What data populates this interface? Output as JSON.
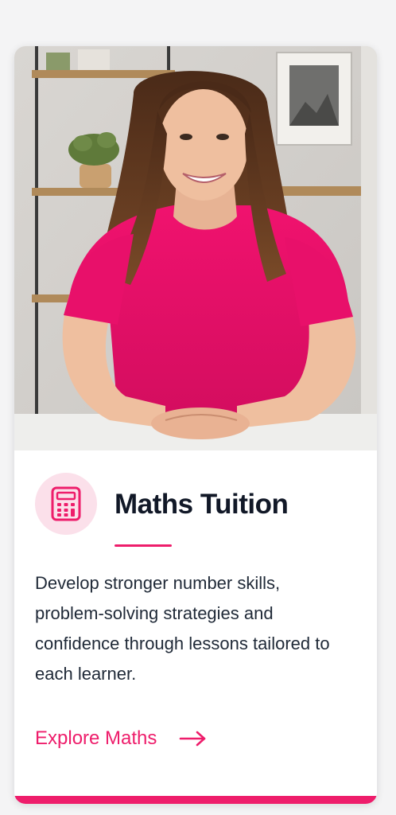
{
  "card": {
    "title": "Maths Tuition",
    "description": "Develop stronger number skills, problem-solving strategies and confidence through lessons tailored to each learner.",
    "cta_label": "Explore Maths",
    "icon": "calculator-icon",
    "cta_icon": "arrow-right-icon",
    "accent_color": "#ee1d6b",
    "icon_bg_color": "#fbe0ea"
  },
  "photo": {
    "subject": "tutor-portrait"
  }
}
